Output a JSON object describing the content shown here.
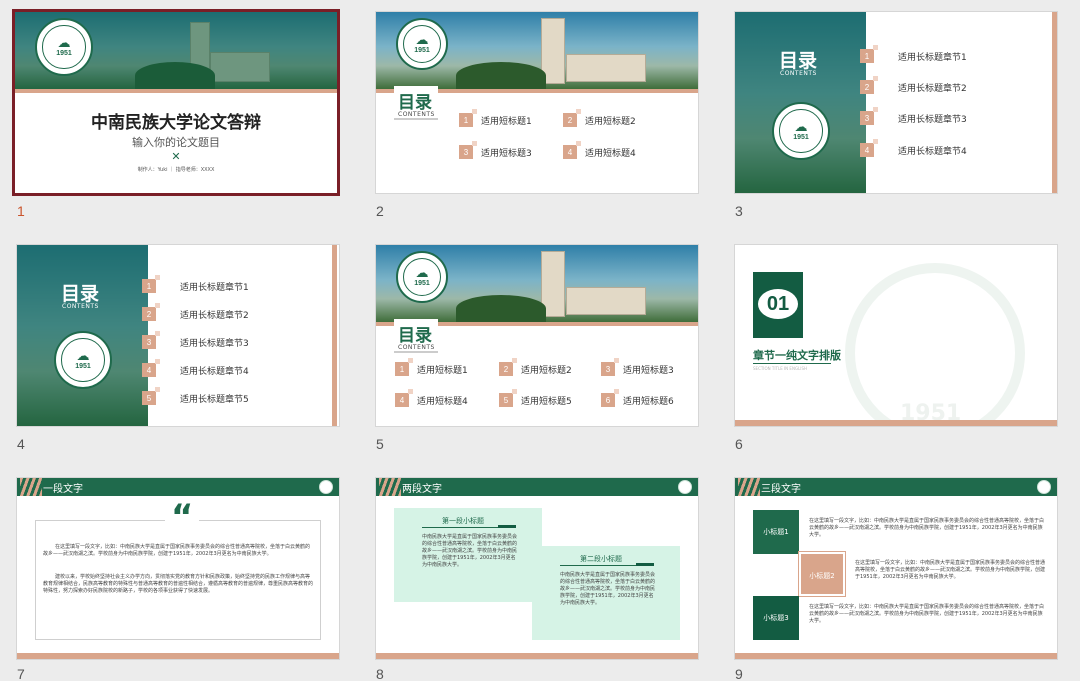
{
  "slides": [
    {
      "num": "1",
      "title": "中南民族大学论文答辩",
      "subtitle": "输入你的论文题目",
      "meta": "制作人：Yuki ｜ 指导老师：XXXX",
      "icon": "close-icon",
      "year": "1951"
    },
    {
      "num": "2",
      "mulu": "目录",
      "contents": "CONTENTS",
      "items": [
        "适用短标题1",
        "适用短标题2",
        "适用短标题3",
        "适用短标题4"
      ],
      "year": "1951"
    },
    {
      "num": "3",
      "mulu": "目录",
      "contents": "CONTENTS",
      "items": [
        "适用长标题章节1",
        "适用长标题章节2",
        "适用长标题章节3",
        "适用长标题章节4"
      ],
      "year": "1951"
    },
    {
      "num": "4",
      "mulu": "目录",
      "contents": "CONTENTS",
      "items": [
        "适用长标题章节1",
        "适用长标题章节2",
        "适用长标题章节3",
        "适用长标题章节4",
        "适用长标题章节5"
      ],
      "year": "1951"
    },
    {
      "num": "5",
      "mulu": "目录",
      "contents": "CONTENTS",
      "items": [
        "适用短标题1",
        "适用短标题2",
        "适用短标题3",
        "适用短标题4",
        "适用短标题5",
        "适用短标题6"
      ],
      "year": "1951"
    },
    {
      "num": "6",
      "chapter": "01",
      "chapter_title": "章节一纯文字排版",
      "chapter_sub": "SECTION TITLE IN ENGLISH",
      "year": "1951"
    },
    {
      "num": "7",
      "header": "一段文字",
      "quote": "“",
      "paragraphs": [
        "在这里填写一段文字，比如：中南民族大学是直属于国家民族事务委员会的综合性普通高等院校，坐落于白云黄鹤的故乡——武汉南湖之滨。学校前身为中南民族学院，创建于1951年，2002年3月更名为中南民族大学。",
        "建校以来，学校始终坚持社会主义办学方向，贯彻落实党的教育方针和民族政策，始终坚持党的民族工作规律与高等教育规律相结合，民族高等教育的特殊性与普通高等教育的普遍性相结合，遵循高等教育的普遍规律，尊重民族高等教育的特殊性，努力探索办好民族院校的新路子，学校的各项事业获得了快速发展。"
      ]
    },
    {
      "num": "8",
      "header": "两段文字",
      "sub1": "第一段小标题",
      "sub2": "第二段小标题",
      "p1": "中南民族大学是直属于国家民族事务委员会的综合性普通高等院校，坐落于白云黄鹤的故乡——武汉南湖之滨。学校前身为中南民族学院，创建于1951年，2002年3月更名为中南民族大学。",
      "p2": "中南民族大学是直属于国家民族事务委员会的综合性普通高等院校，坐落于白云黄鹤的故乡——武汉南湖之滨。学校前身为中南民族学院，创建于1951年，2002年3月更名为中南民族大学。"
    },
    {
      "num": "9",
      "header": "三段文字",
      "subs": [
        "小标题1",
        "小标题2",
        "小标题3"
      ],
      "paras": [
        "在这里填写一段文字，比如：中南民族大学是直属于国家民族事务委员会的综合性普通高等院校，坐落于白云黄鹤的故乡——武汉南湖之滨。学校前身为中南民族学院，创建于1951年，2002年3月更名为中南民族大学。",
        "在这里填写一段文字，比如：中南民族大学是直属于国家民族事务委员会的综合性普通高等院校，坐落于白云黄鹤的故乡——武汉南湖之滨。学校前身为中南民族学院，创建于1951年，2002年3月更名为中南民族大学。",
        "在这里填写一段文字，比如：中南民族大学是直属于国家民族事务委员会的综合性普通高等院校，坐落于白云黄鹤的故乡——武汉南湖之滨。学校前身为中南民族学院，创建于1951年，2002年3月更名为中南民族大学。"
      ]
    }
  ],
  "colors": {
    "green": "#1f6a4c",
    "peach": "#d9a58b",
    "selected": "#7a1f27"
  }
}
